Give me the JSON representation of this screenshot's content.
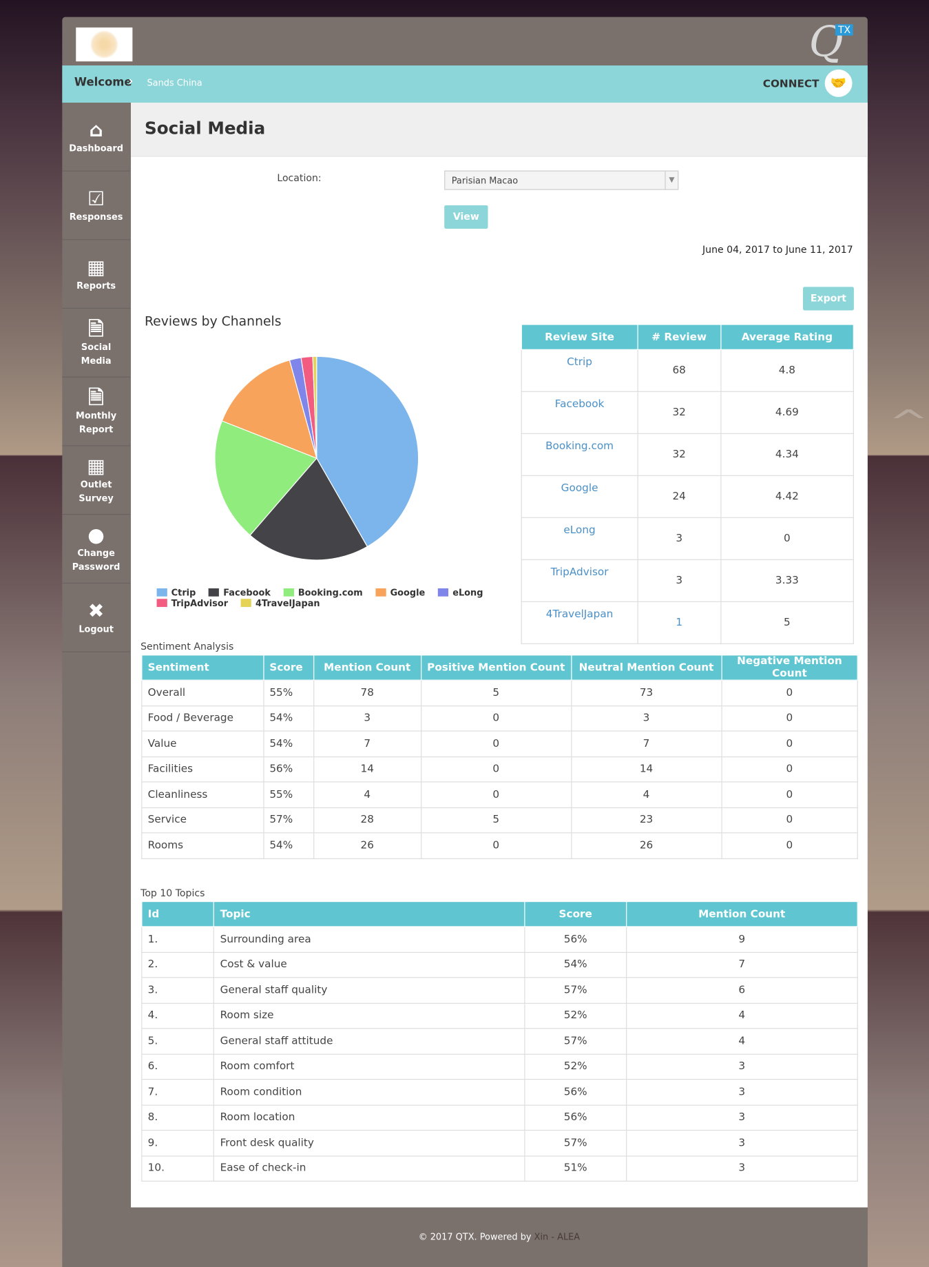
{
  "header": {
    "logo_text": "Sands China",
    "brand": "Q",
    "brand_badge": "TX"
  },
  "bar": {
    "welcome": "Welcome",
    "crumb": "Sands China",
    "connect": "CONNECT"
  },
  "sidebar": {
    "items": [
      {
        "label": "Dashboard",
        "icon": "home-icon"
      },
      {
        "label": "Responses",
        "icon": "checkbox-icon"
      },
      {
        "label": "Reports",
        "icon": "grid-icon"
      },
      {
        "label": "Social Media",
        "icon": "document-icon"
      },
      {
        "label": "Monthly Report",
        "icon": "document-icon"
      },
      {
        "label": "Outlet Survey",
        "icon": "grid-icon"
      },
      {
        "label": "Change Password",
        "icon": "user-icon"
      },
      {
        "label": "Logout",
        "icon": "user-remove-icon"
      }
    ]
  },
  "page": {
    "title": "Social Media",
    "location_label": "Location:",
    "location_value": "Parisian Macao",
    "view": "View",
    "date_range": "June 04, 2017 to June 11, 2017",
    "export": "Export"
  },
  "chart_data": {
    "type": "pie",
    "title": "Reviews by Channels",
    "legend": "bottom",
    "categories": [
      "Ctrip",
      "Facebook",
      "Booking.com",
      "Google",
      "eLong",
      "TripAdvisor",
      "4TravelJapan"
    ],
    "values": [
      68,
      32,
      32,
      24,
      3,
      3,
      1
    ],
    "colors": [
      "#7cb5ec",
      "#434348",
      "#90ed7d",
      "#f7a35c",
      "#8085e9",
      "#f15c80",
      "#e4d354"
    ]
  },
  "review_table": {
    "headers": [
      "Review Site",
      "# Review",
      "Average Rating"
    ],
    "rows": [
      [
        "Ctrip",
        "68",
        "4.8"
      ],
      [
        "Facebook",
        "32",
        "4.69"
      ],
      [
        "Booking.com",
        "32",
        "4.34"
      ],
      [
        "Google",
        "24",
        "4.42"
      ],
      [
        "eLong",
        "3",
        "0"
      ],
      [
        "TripAdvisor",
        "3",
        "3.33"
      ],
      [
        "4TravelJapan",
        "1",
        "5"
      ]
    ]
  },
  "sentiment": {
    "title": "Sentiment Analysis",
    "headers": [
      "Sentiment",
      "Score",
      "Mention Count",
      "Positive Mention Count",
      "Neutral Mention Count",
      "Negative Mention Count"
    ],
    "rows": [
      [
        "Overall",
        "55%",
        "78",
        "5",
        "73",
        "0"
      ],
      [
        "Food / Beverage",
        "54%",
        "3",
        "0",
        "3",
        "0"
      ],
      [
        "Value",
        "54%",
        "7",
        "0",
        "7",
        "0"
      ],
      [
        "Facilities",
        "56%",
        "14",
        "0",
        "14",
        "0"
      ],
      [
        "Cleanliness",
        "55%",
        "4",
        "0",
        "4",
        "0"
      ],
      [
        "Service",
        "57%",
        "28",
        "5",
        "23",
        "0"
      ],
      [
        "Rooms",
        "54%",
        "26",
        "0",
        "26",
        "0"
      ]
    ]
  },
  "topics": {
    "title": "Top 10 Topics",
    "headers": [
      "Id",
      "Topic",
      "Score",
      "Mention Count"
    ],
    "rows": [
      [
        "1.",
        "Surrounding area",
        "56%",
        "9"
      ],
      [
        "2.",
        "Cost & value",
        "54%",
        "7"
      ],
      [
        "3.",
        "General staff quality",
        "57%",
        "6"
      ],
      [
        "4.",
        "Room size",
        "52%",
        "4"
      ],
      [
        "5.",
        "General staff attitude",
        "57%",
        "4"
      ],
      [
        "6.",
        "Room comfort",
        "52%",
        "3"
      ],
      [
        "7.",
        "Room condition",
        "56%",
        "3"
      ],
      [
        "8.",
        "Room location",
        "56%",
        "3"
      ],
      [
        "9.",
        "Front desk quality",
        "57%",
        "3"
      ],
      [
        "10.",
        "Ease of check-in",
        "51%",
        "3"
      ]
    ]
  },
  "footer": {
    "text": "© 2017 QTX. Powered by",
    "link1": "Xin",
    "sep": "-",
    "link2": "ALEA"
  }
}
